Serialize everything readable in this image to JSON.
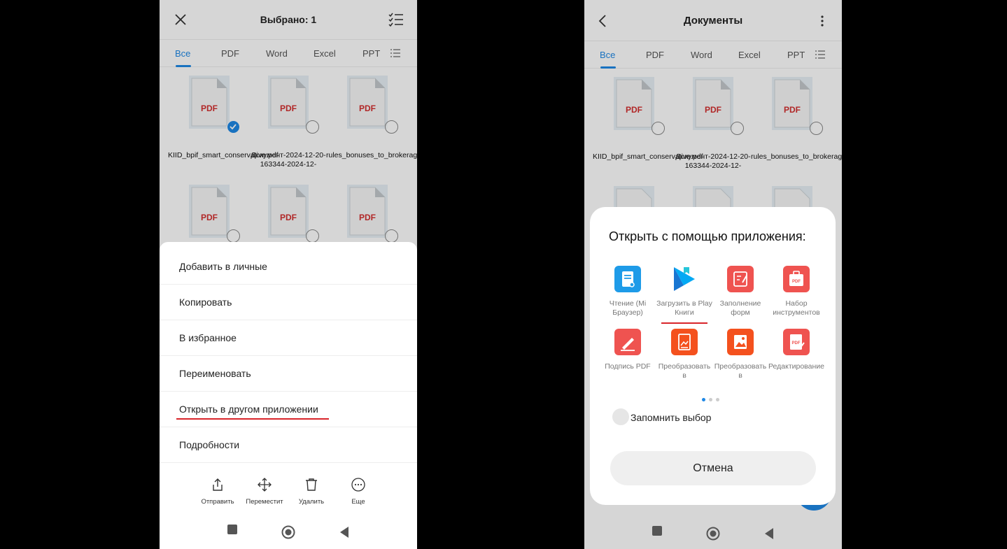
{
  "left": {
    "header": {
      "title": "Выбрано: 1",
      "close_icon": "close-icon",
      "select_all_icon": "checklist-icon"
    },
    "tabs": [
      {
        "label": "Все",
        "active": true
      },
      {
        "label": "PDF"
      },
      {
        "label": "Word"
      },
      {
        "label": "Excel"
      },
      {
        "label": "PPT"
      }
    ],
    "files": [
      {
        "type": "PDF",
        "name": "KIID_bpif_smart_conservative.pdf",
        "selected": true
      },
      {
        "type": "PDF",
        "name": "Документ-2024-12-20-163344-2024-12-",
        "selected": false
      },
      {
        "type": "PDF",
        "name": "rules_bonuses_to_brokerage_acc.pdf",
        "selected": false
      },
      {
        "type": "PDF",
        "name": "",
        "selected": false
      },
      {
        "type": "PDF",
        "name": "",
        "selected": false
      },
      {
        "type": "PDF",
        "name": "",
        "selected": false
      }
    ],
    "menu": [
      {
        "label": "Добавить в личные"
      },
      {
        "label": "Копировать"
      },
      {
        "label": "В избранное"
      },
      {
        "label": "Переименовать"
      },
      {
        "label": "Открыть в другом приложении",
        "highlighted": true
      },
      {
        "label": "Подробности"
      }
    ],
    "actions": [
      {
        "label": "Отправить",
        "icon": "share-icon"
      },
      {
        "label": "Переместит",
        "icon": "move-icon"
      },
      {
        "label": "Удалить",
        "icon": "trash-icon"
      },
      {
        "label": "Еще",
        "icon": "more-icon"
      }
    ]
  },
  "right": {
    "header": {
      "title": "Документы",
      "back_icon": "back-icon",
      "menu_icon": "more-vert-icon"
    },
    "tabs": [
      {
        "label": "Все",
        "active": true
      },
      {
        "label": "PDF"
      },
      {
        "label": "Word"
      },
      {
        "label": "Excel"
      },
      {
        "label": "PPT"
      }
    ],
    "files": [
      {
        "type": "PDF",
        "name": "KIID_bpif_smart_conservative.pdf"
      },
      {
        "type": "PDF",
        "name": "Документ-2024-12-20-163344-2024-12-"
      },
      {
        "type": "PDF",
        "name": "rules_bonuses_to_brokerage_acc.pdf"
      }
    ],
    "dialog": {
      "title": "Открыть с помощью приложения:",
      "apps": [
        {
          "label": "Чтение (Mi Браузер)",
          "icon": "mi-reader-icon"
        },
        {
          "label": "Загрузить в Play Книги",
          "icon": "play-books-icon",
          "highlighted": true
        },
        {
          "label": "Заполнение форм",
          "icon": "form-fill-icon"
        },
        {
          "label": "Набор инструментов",
          "icon": "pdf-tools-icon"
        },
        {
          "label": "Подпись PDF",
          "icon": "pdf-sign-icon"
        },
        {
          "label": "Преобразовать в",
          "icon": "convert-icon"
        },
        {
          "label": "Преобразовать в",
          "icon": "convert-image-icon"
        },
        {
          "label": "Редактирование",
          "icon": "pdf-edit-icon"
        }
      ],
      "page_count": 3,
      "page_active": 1,
      "remember_label": "Запомнить выбор",
      "cancel_label": "Отмена"
    }
  },
  "colors": {
    "accent": "#1e88e5",
    "pdf_red": "#d32f2f",
    "highlight_red": "#d9242a"
  }
}
